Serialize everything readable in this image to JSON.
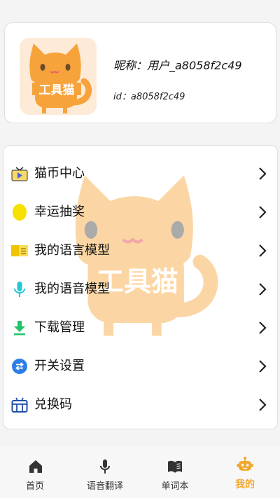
{
  "profile": {
    "avatar_icon": "tool-cat-logo",
    "nickname": "昵称：用户_a8058f2c49",
    "user_id": "id：a8058f2c49"
  },
  "menu": {
    "items": [
      {
        "label": "猫币中心",
        "icon": "tv-play-icon"
      },
      {
        "label": "幸运抽奖",
        "icon": "coin-icon"
      },
      {
        "label": "我的语言模型",
        "icon": "document-icon"
      },
      {
        "label": "我的语音模型",
        "icon": "microphone-icon"
      },
      {
        "label": "下载管理",
        "icon": "download-icon"
      },
      {
        "label": "开关设置",
        "icon": "switch-arrows-icon"
      },
      {
        "label": "兑换码",
        "icon": "gift-box-icon"
      }
    ]
  },
  "bottom_nav": {
    "items": [
      {
        "label": "首页",
        "icon": "home-icon"
      },
      {
        "label": "语音翻译",
        "icon": "microphone-icon"
      },
      {
        "label": "单词本",
        "icon": "book-icon"
      },
      {
        "label": "我的",
        "icon": "robot-icon",
        "active": true
      }
    ]
  },
  "colors": {
    "accent": "#f1a72c",
    "cat_orange": "#f6a33c",
    "background": "#f4f4f4"
  }
}
